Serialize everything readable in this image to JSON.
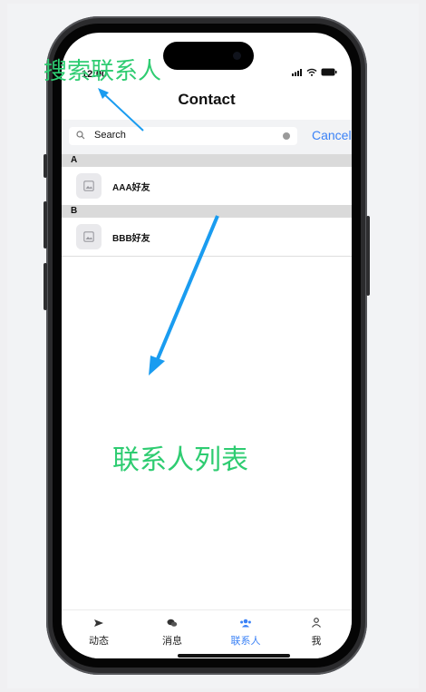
{
  "status_bar": {
    "time": "12:00"
  },
  "nav": {
    "title": "Contact"
  },
  "search": {
    "placeholder": "Search",
    "cancel_label": "Cancel"
  },
  "sections": [
    {
      "letter": "A",
      "contacts": [
        {
          "name": "AAA好友"
        }
      ]
    },
    {
      "letter": "B",
      "contacts": [
        {
          "name": "BBB好友"
        }
      ]
    }
  ],
  "tabs": [
    {
      "label": "动态",
      "icon": "send-icon",
      "active": false
    },
    {
      "label": "消息",
      "icon": "chat-bubble-icon",
      "active": false
    },
    {
      "label": "联系人",
      "icon": "people-icon",
      "active": true
    },
    {
      "label": "我",
      "icon": "person-icon",
      "active": false
    }
  ],
  "annotations": {
    "search_note": "搜索联系人",
    "list_note": "联系人列表"
  },
  "colors": {
    "accent": "#3b82f6",
    "annotation_text": "#2ecc71",
    "annotation_arrow": "#1a9cf0",
    "section_header": "#dadada"
  }
}
